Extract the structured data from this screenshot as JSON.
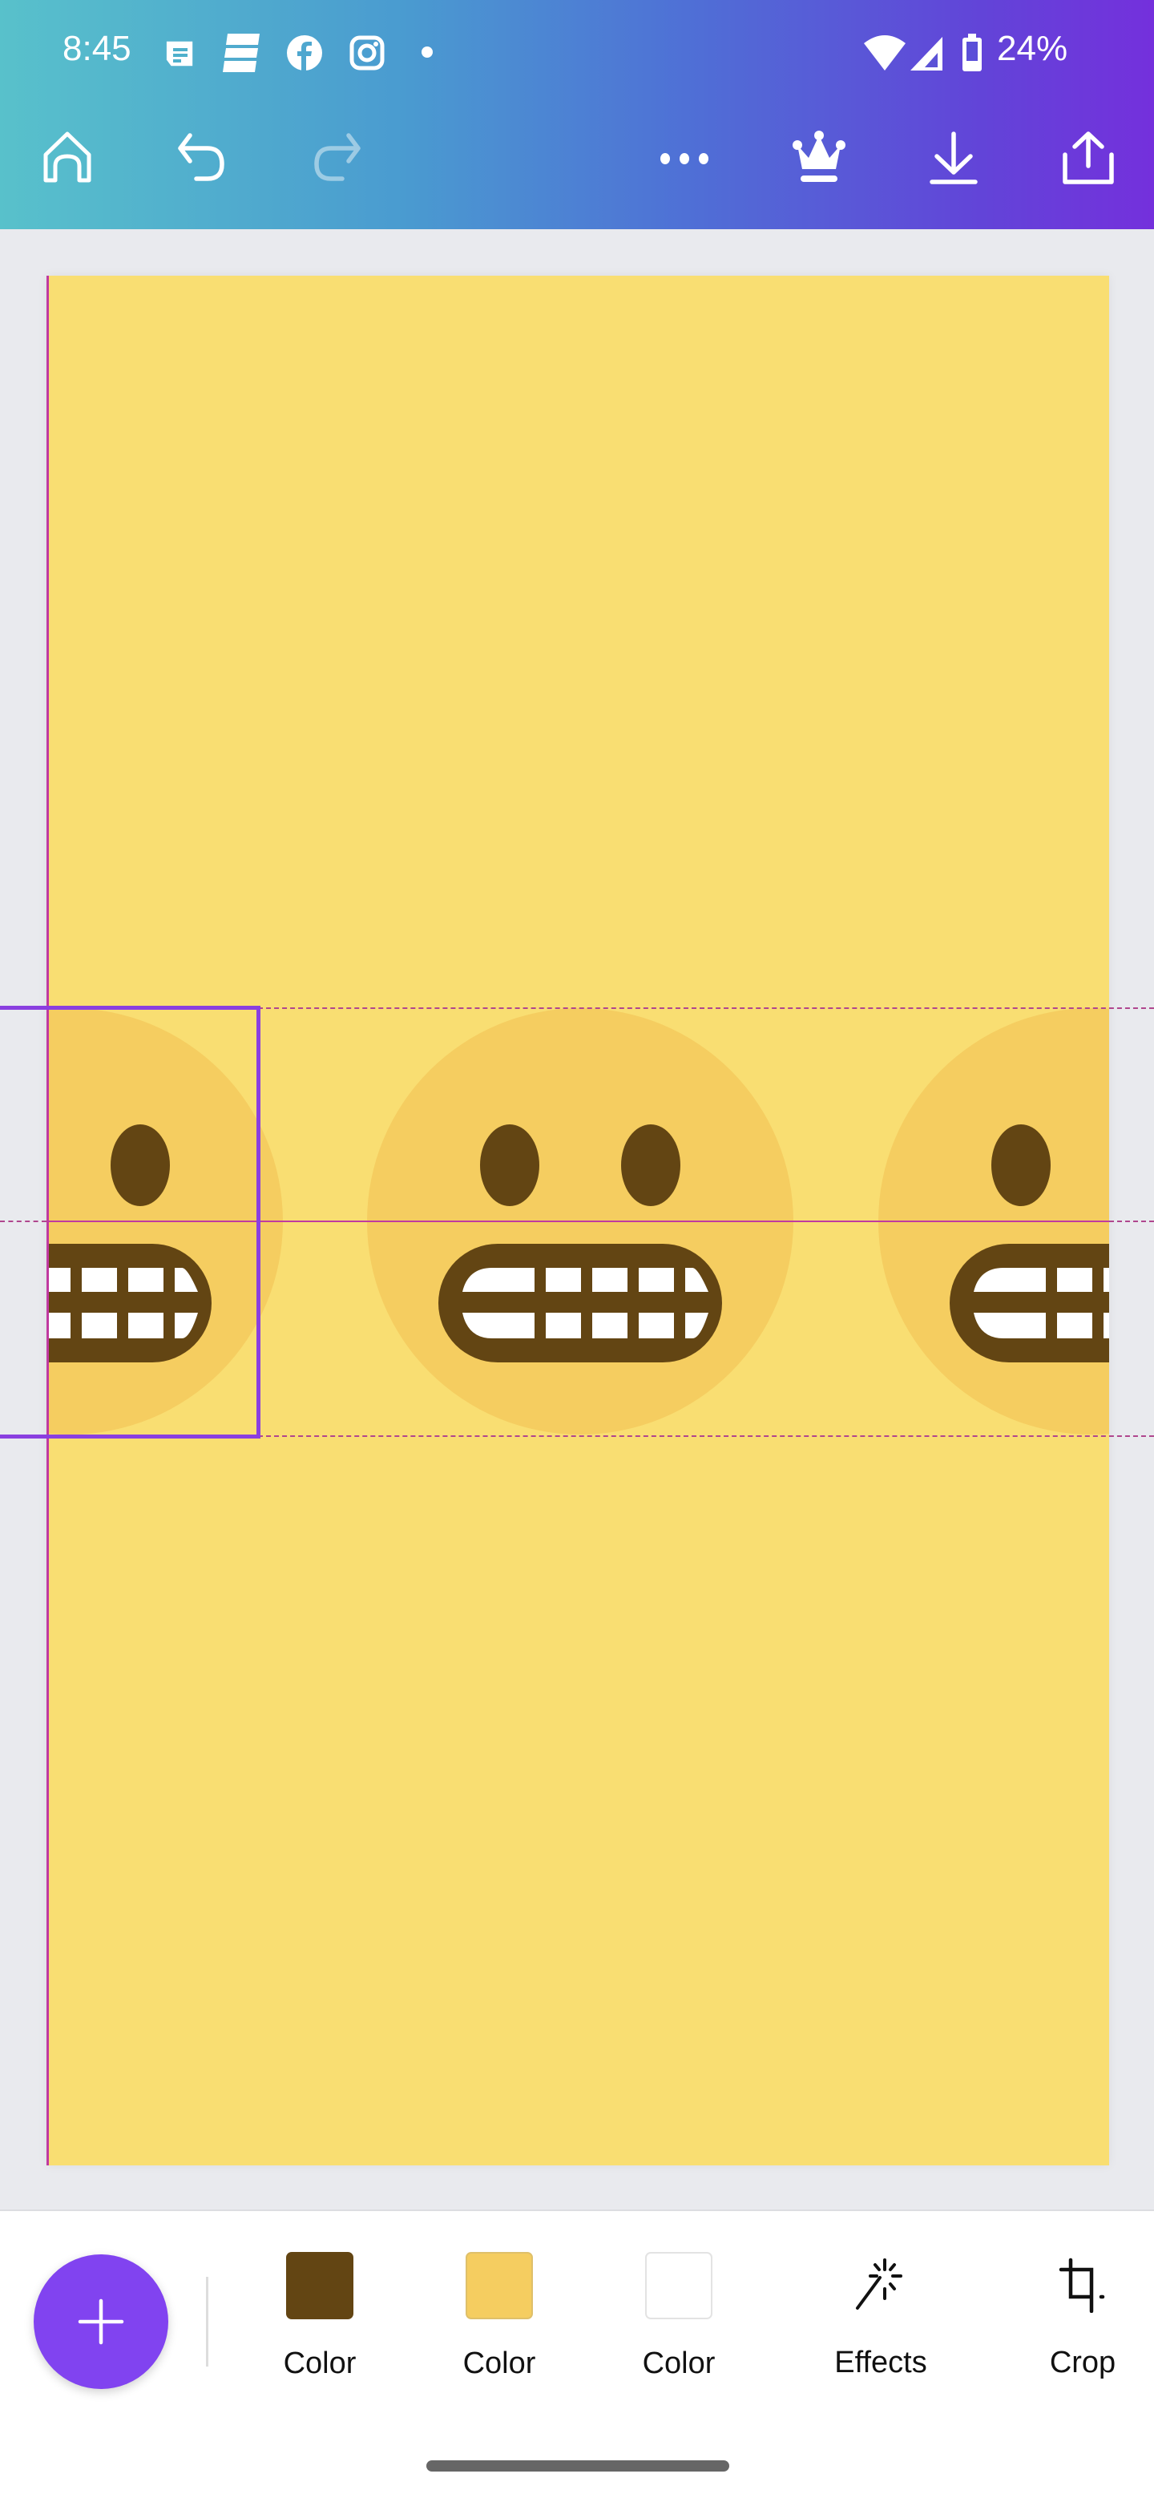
{
  "status_bar": {
    "time": "8:45",
    "notification_icons": [
      "messages-icon",
      "news-icon",
      "facebook-icon",
      "instagram-icon",
      "dot-icon"
    ],
    "system_icons": [
      "wifi-icon",
      "signal-icon",
      "battery-icon"
    ],
    "battery_percent": "24%"
  },
  "toolbar": {
    "buttons": [
      {
        "name": "home",
        "icon": "home-icon",
        "enabled": true
      },
      {
        "name": "undo",
        "icon": "undo-icon",
        "enabled": true
      },
      {
        "name": "redo",
        "icon": "redo-icon",
        "enabled": false
      },
      {
        "name": "more",
        "icon": "more-horizontal-icon",
        "enabled": true
      },
      {
        "name": "premium",
        "icon": "crown-icon",
        "enabled": true
      },
      {
        "name": "download",
        "icon": "download-icon",
        "enabled": true
      },
      {
        "name": "share",
        "icon": "share-icon",
        "enabled": true
      }
    ]
  },
  "canvas": {
    "background_color": "#f9de72",
    "element": "grimacing-face-emoji pattern (repeated horizontally)",
    "emoji_colors": {
      "face": "#f5cd60",
      "features": "#634513",
      "teeth": "#ffffff"
    },
    "selection_color": "#8a3fe0",
    "guide_color": "#c03aa0"
  },
  "bottom_toolbar": {
    "add_button_icon": "plus-icon",
    "add_button_color": "#8143f0",
    "tools": [
      {
        "label": "Color",
        "type": "swatch",
        "color": "#634513"
      },
      {
        "label": "Color",
        "type": "swatch",
        "color": "#f5cd60"
      },
      {
        "label": "Color",
        "type": "swatch",
        "color": "#ffffff"
      },
      {
        "label": "Effects",
        "type": "icon",
        "icon": "magic-wand-icon"
      },
      {
        "label": "Crop",
        "type": "icon",
        "icon": "crop-icon"
      }
    ]
  }
}
